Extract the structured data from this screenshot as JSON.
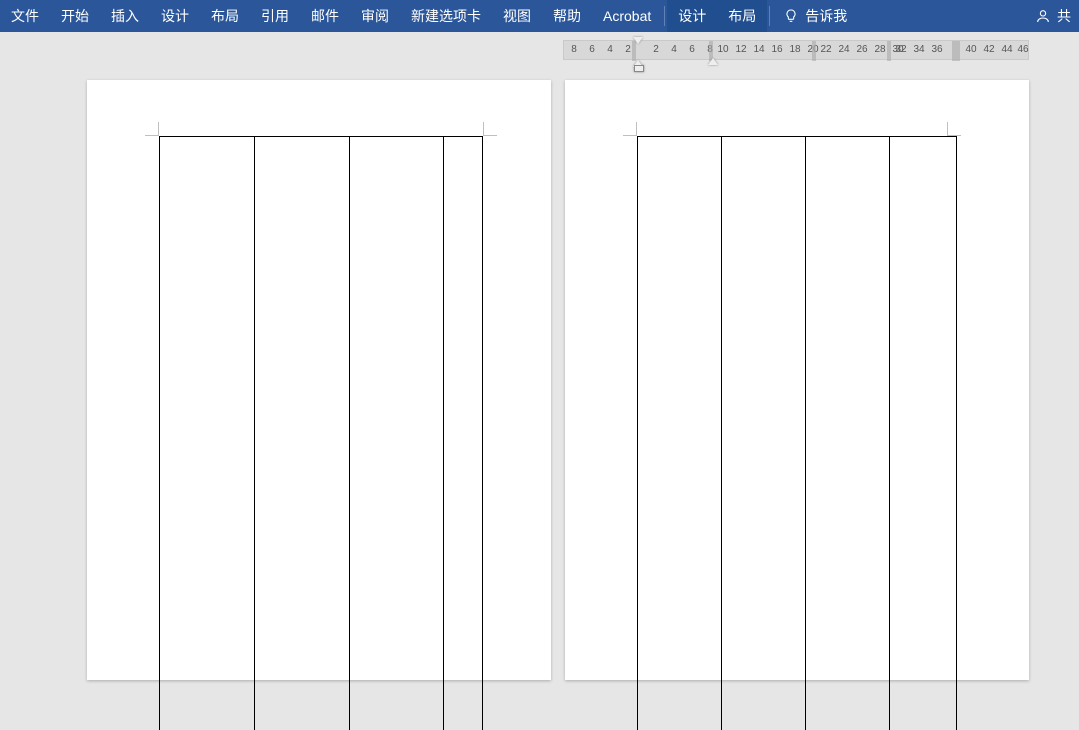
{
  "ribbon": {
    "tabs": [
      "文件",
      "开始",
      "插入",
      "设计",
      "布局",
      "引用",
      "邮件",
      "审阅",
      "新建选项卡",
      "视图",
      "帮助",
      "Acrobat"
    ],
    "context_tabs": [
      "设计",
      "布局"
    ],
    "tell_me_label": "告诉我",
    "share_label": "共"
  },
  "ruler": {
    "left_numbers": [
      "8",
      "6",
      "4",
      "2"
    ],
    "right_numbers": [
      "2",
      "4",
      "6",
      "8",
      "10",
      "12",
      "14",
      "16",
      "18",
      "20",
      "22",
      "24",
      "26",
      "28",
      "30",
      "32",
      "34",
      "36"
    ],
    "gap_numbers": [
      "40",
      "42",
      "44",
      "46"
    ]
  }
}
